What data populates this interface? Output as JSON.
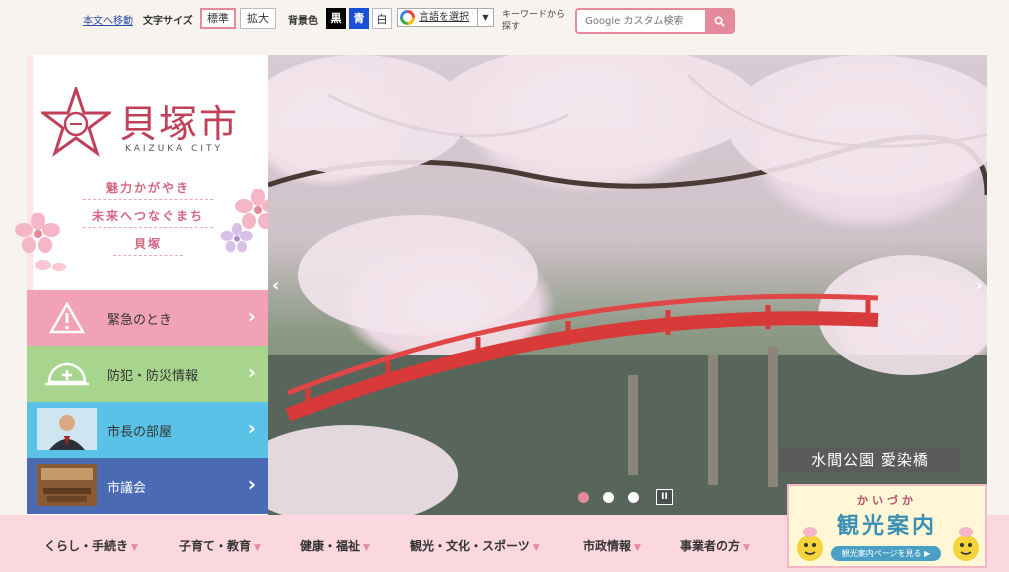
{
  "topbar": {
    "skip_link": "本文へ移動",
    "font_size_label": "文字サイズ",
    "font_standard": "標準",
    "font_large": "拡大",
    "bg_color_label": "背景色",
    "bg_black": "黒",
    "bg_blue": "青",
    "bg_white": "白",
    "translate_label": "言語を選択",
    "keyword_label": "キーワードから探す",
    "search_placeholder": "Google カスタム検索"
  },
  "logo": {
    "name": "貝塚市",
    "sub": "KAIZUKA CITY"
  },
  "slogan": [
    "魅力かがやき",
    "未来へつなぐまち",
    "貝塚"
  ],
  "quick_links": [
    {
      "label": "緊急のとき",
      "color": "#f2a2b7"
    },
    {
      "label": "防犯・防災情報",
      "color": "#a8d58d"
    },
    {
      "label": "市長の部屋",
      "color": "#59c2e6"
    },
    {
      "label": "市議会",
      "color": "#4a6bb4"
    }
  ],
  "hero": {
    "caption": "水間公園 愛染橋"
  },
  "global_nav": [
    "くらし・手続き",
    "子育て・教育",
    "健康・福祉",
    "観光・文化・スポーツ",
    "市政情報",
    "事業者の方"
  ],
  "banner": {
    "line1": "かいづか",
    "line2": "観光案内",
    "button": "観光案内ページを見る ▶"
  },
  "colors": {
    "accent_pink": "#e58a9b",
    "nav_bg": "#fbd7df",
    "logo_red": "#c0405a"
  }
}
